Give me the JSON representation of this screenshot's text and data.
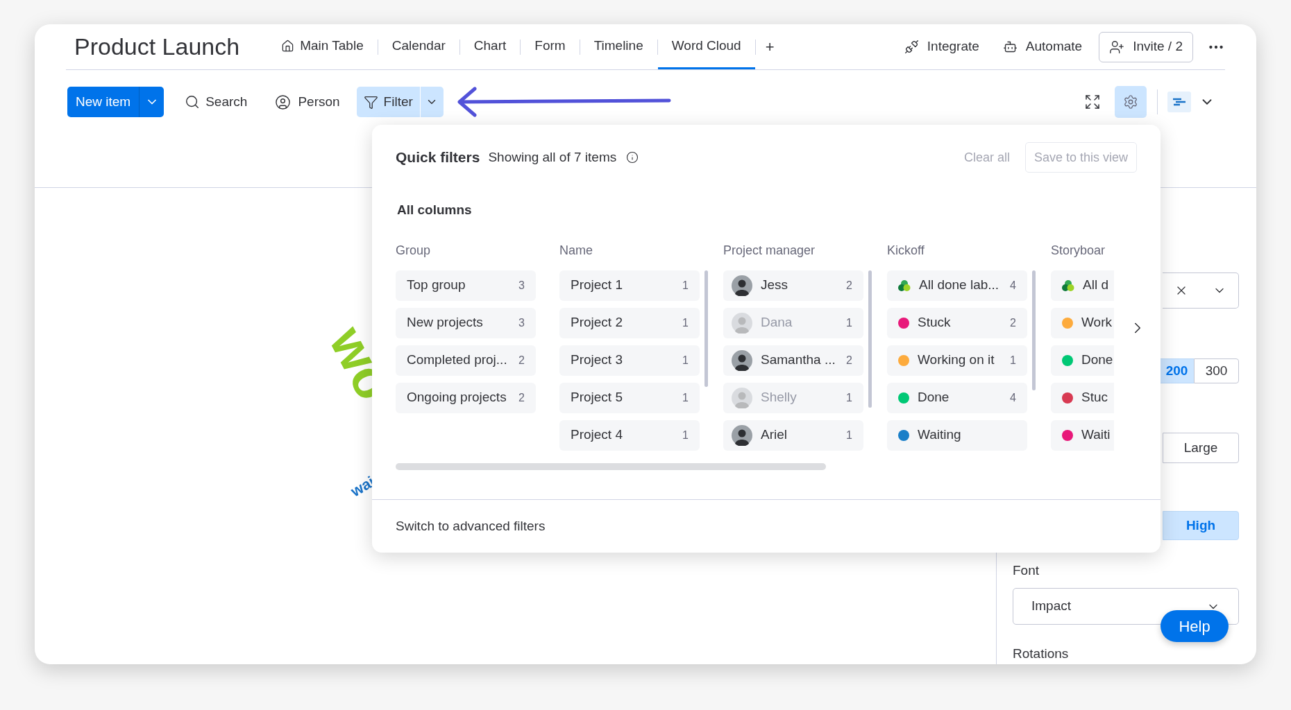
{
  "header": {
    "title": "Product Launch",
    "views": [
      {
        "label": "Main Table",
        "kind": "home",
        "selected": false
      },
      {
        "label": "Calendar",
        "selected": false
      },
      {
        "label": "Chart",
        "selected": false
      },
      {
        "label": "Form",
        "selected": false
      },
      {
        "label": "Timeline",
        "selected": false
      },
      {
        "label": "Word Cloud",
        "selected": true
      }
    ],
    "add_view": "+",
    "actions": [
      {
        "label": "Integrate",
        "kind": "integrate"
      },
      {
        "label": "Automate",
        "kind": "automate"
      }
    ],
    "invite": "Invite / 2"
  },
  "toolbar": {
    "new_item": "New item",
    "search": "Search",
    "person": "Person",
    "filter": {
      "label": "Filter",
      "active": true
    }
  },
  "word_cloud": [
    {
      "text": "wo",
      "color": "#8fce27",
      "kind": "large"
    },
    {
      "text": "wai",
      "color": "#1a73c8",
      "kind": "small"
    }
  ],
  "quick_filters": {
    "title": "Quick filters",
    "summary": "Showing all of 7 items",
    "clear": "Clear all",
    "save": "Save to this view",
    "section": "All columns",
    "columns": [
      {
        "header": "Group",
        "options": [
          {
            "kind": "text",
            "label": "Top group",
            "count": "3"
          },
          {
            "kind": "text",
            "label": "New projects",
            "count": "3"
          },
          {
            "kind": "text",
            "label": "Completed proj...",
            "count": "2"
          },
          {
            "kind": "text",
            "label": "Ongoing projects",
            "count": "2"
          }
        ]
      },
      {
        "header": "Name",
        "options": [
          {
            "kind": "text",
            "label": "Project 1",
            "count": "1"
          },
          {
            "kind": "text",
            "label": "Project 2",
            "count": "1"
          },
          {
            "kind": "text",
            "label": "Project 3",
            "count": "1"
          },
          {
            "kind": "text",
            "label": "Project 5",
            "count": "1"
          },
          {
            "kind": "text",
            "label": "Project 4",
            "count": "1"
          }
        ]
      },
      {
        "header": "Project manager",
        "options": [
          {
            "kind": "person",
            "label": "Jess",
            "count": "2",
            "disabled": false
          },
          {
            "kind": "person",
            "label": "Dana",
            "count": "1",
            "disabled": true
          },
          {
            "kind": "person",
            "label": "Samantha ...",
            "count": "2",
            "disabled": false
          },
          {
            "kind": "person",
            "label": "Shelly",
            "count": "1",
            "disabled": true
          },
          {
            "kind": "person",
            "label": "Ariel",
            "count": "1",
            "disabled": false
          }
        ]
      },
      {
        "header": "Kickoff",
        "options": [
          {
            "kind": "all",
            "label": "All done lab...",
            "count": "4"
          },
          {
            "kind": "status",
            "label": "Stuck",
            "count": "2",
            "color": "#e8197a"
          },
          {
            "kind": "status",
            "label": "Working on it",
            "count": "1",
            "color": "#fdab3d"
          },
          {
            "kind": "status",
            "label": "Done",
            "count": "4",
            "color": "#00c875"
          },
          {
            "kind": "status",
            "label": "Waiting",
            "color": "#1a7fc8"
          }
        ]
      },
      {
        "header": "Storyboar",
        "options": [
          {
            "kind": "all",
            "label": "All d"
          },
          {
            "kind": "status",
            "label": "Work",
            "color": "#fdab3d"
          },
          {
            "kind": "status",
            "label": "Done",
            "color": "#00c875"
          },
          {
            "kind": "status",
            "label": "Stuc",
            "color": "#d83a52"
          },
          {
            "kind": "status",
            "label": "Waiti",
            "color": "#e8197a"
          }
        ]
      }
    ],
    "footer": "Switch to advanced filters"
  },
  "settings": {
    "count_options": [
      {
        "label": "200",
        "selected": true
      },
      {
        "label": "300",
        "selected": false
      }
    ],
    "size_options": [
      {
        "label": "Large",
        "selected": false
      }
    ],
    "quality_options": [
      {
        "label": "High",
        "selected": true
      }
    ],
    "font_label": "Font",
    "font_value": "Impact",
    "rotations_label": "Rotations"
  },
  "help": "Help"
}
